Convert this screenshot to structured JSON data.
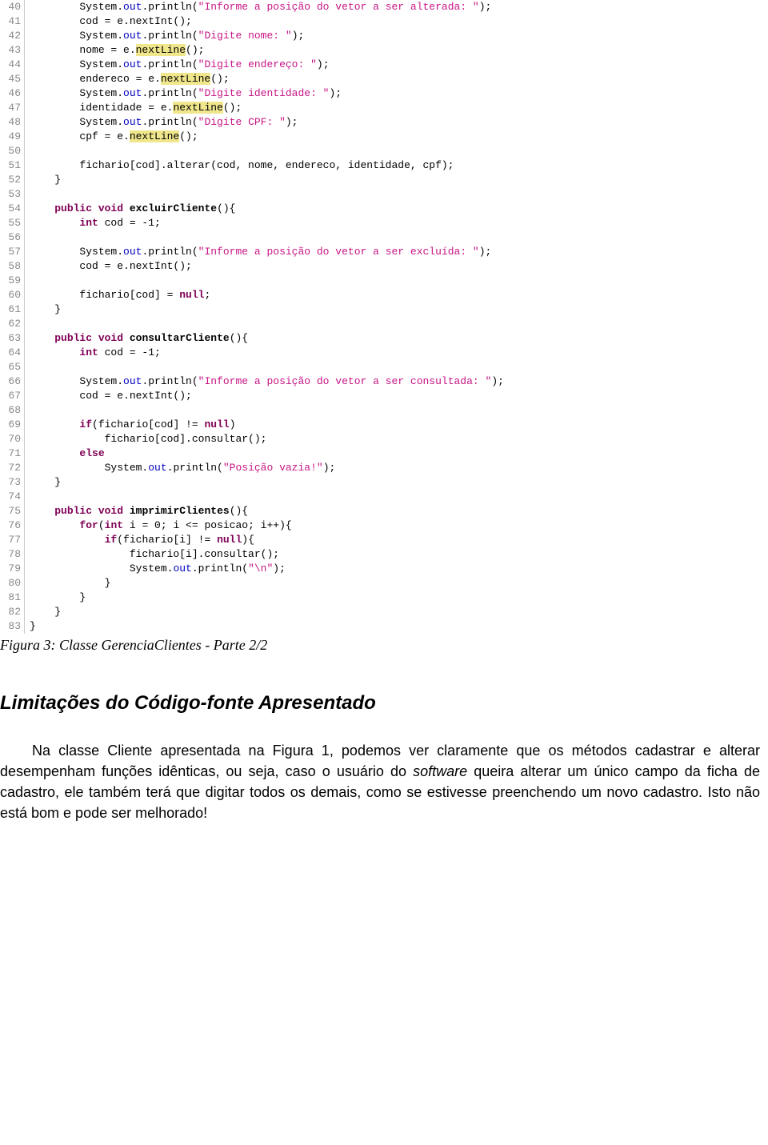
{
  "lines": [
    {
      "n": 40,
      "segs": [
        {
          "t": "        System."
        },
        {
          "t": "out",
          "c": "field"
        },
        {
          "t": ".println("
        },
        {
          "t": "\"Informe a posição do vetor a ser alterada: \"",
          "c": "str"
        },
        {
          "t": ");"
        }
      ]
    },
    {
      "n": 41,
      "segs": [
        {
          "t": "        cod = e.nextInt();"
        }
      ]
    },
    {
      "n": 42,
      "segs": [
        {
          "t": "        System."
        },
        {
          "t": "out",
          "c": "field"
        },
        {
          "t": ".println("
        },
        {
          "t": "\"Digite nome: \"",
          "c": "str"
        },
        {
          "t": ");"
        }
      ]
    },
    {
      "n": 43,
      "segs": [
        {
          "t": "        nome = e."
        },
        {
          "t": "nextLine",
          "c": "hl"
        },
        {
          "t": "();"
        }
      ]
    },
    {
      "n": 44,
      "segs": [
        {
          "t": "        System."
        },
        {
          "t": "out",
          "c": "field"
        },
        {
          "t": ".println("
        },
        {
          "t": "\"Digite endereço: \"",
          "c": "str"
        },
        {
          "t": ");"
        }
      ]
    },
    {
      "n": 45,
      "segs": [
        {
          "t": "        endereco = e."
        },
        {
          "t": "nextLine",
          "c": "hl"
        },
        {
          "t": "();"
        }
      ]
    },
    {
      "n": 46,
      "segs": [
        {
          "t": "        System."
        },
        {
          "t": "out",
          "c": "field"
        },
        {
          "t": ".println("
        },
        {
          "t": "\"Digite identidade: \"",
          "c": "str"
        },
        {
          "t": ");"
        }
      ]
    },
    {
      "n": 47,
      "segs": [
        {
          "t": "        identidade = e."
        },
        {
          "t": "nextLine",
          "c": "hl"
        },
        {
          "t": "();"
        }
      ]
    },
    {
      "n": 48,
      "segs": [
        {
          "t": "        System."
        },
        {
          "t": "out",
          "c": "field"
        },
        {
          "t": ".println("
        },
        {
          "t": "\"Digite CPF: \"",
          "c": "str"
        },
        {
          "t": ");"
        }
      ]
    },
    {
      "n": 49,
      "segs": [
        {
          "t": "        cpf = e."
        },
        {
          "t": "nextLine",
          "c": "hl"
        },
        {
          "t": "();"
        }
      ]
    },
    {
      "n": 50,
      "segs": [
        {
          "t": ""
        }
      ]
    },
    {
      "n": 51,
      "segs": [
        {
          "t": "        fichario[cod].alterar(cod, nome, endereco, identidade, cpf);"
        }
      ]
    },
    {
      "n": 52,
      "segs": [
        {
          "t": "    }"
        }
      ]
    },
    {
      "n": 53,
      "segs": [
        {
          "t": ""
        }
      ]
    },
    {
      "n": 54,
      "segs": [
        {
          "t": "    "
        },
        {
          "t": "public void",
          "c": "kw"
        },
        {
          "t": " "
        },
        {
          "t": "excluirCliente",
          "c": "bold"
        },
        {
          "t": "(){"
        }
      ]
    },
    {
      "n": 55,
      "segs": [
        {
          "t": "        "
        },
        {
          "t": "int",
          "c": "kw"
        },
        {
          "t": " cod = -1;"
        }
      ]
    },
    {
      "n": 56,
      "segs": [
        {
          "t": ""
        }
      ]
    },
    {
      "n": 57,
      "segs": [
        {
          "t": "        System."
        },
        {
          "t": "out",
          "c": "field"
        },
        {
          "t": ".println("
        },
        {
          "t": "\"Informe a posição do vetor a ser excluída: \"",
          "c": "str"
        },
        {
          "t": ");"
        }
      ]
    },
    {
      "n": 58,
      "segs": [
        {
          "t": "        cod = e.nextInt();"
        }
      ]
    },
    {
      "n": 59,
      "segs": [
        {
          "t": ""
        }
      ]
    },
    {
      "n": 60,
      "segs": [
        {
          "t": "        fichario[cod] = "
        },
        {
          "t": "null",
          "c": "kw"
        },
        {
          "t": ";"
        }
      ]
    },
    {
      "n": 61,
      "segs": [
        {
          "t": "    }"
        }
      ]
    },
    {
      "n": 62,
      "segs": [
        {
          "t": ""
        }
      ]
    },
    {
      "n": 63,
      "segs": [
        {
          "t": "    "
        },
        {
          "t": "public void",
          "c": "kw"
        },
        {
          "t": " "
        },
        {
          "t": "consultarCliente",
          "c": "bold"
        },
        {
          "t": "(){"
        }
      ]
    },
    {
      "n": 64,
      "segs": [
        {
          "t": "        "
        },
        {
          "t": "int",
          "c": "kw"
        },
        {
          "t": " cod = -1;"
        }
      ]
    },
    {
      "n": 65,
      "segs": [
        {
          "t": ""
        }
      ]
    },
    {
      "n": 66,
      "segs": [
        {
          "t": "        System."
        },
        {
          "t": "out",
          "c": "field"
        },
        {
          "t": ".println("
        },
        {
          "t": "\"Informe a posição do vetor a ser consultada: \"",
          "c": "str"
        },
        {
          "t": ");"
        }
      ]
    },
    {
      "n": 67,
      "segs": [
        {
          "t": "        cod = e.nextInt();"
        }
      ]
    },
    {
      "n": 68,
      "segs": [
        {
          "t": ""
        }
      ]
    },
    {
      "n": 69,
      "segs": [
        {
          "t": "        "
        },
        {
          "t": "if",
          "c": "kw"
        },
        {
          "t": "(fichario[cod] != "
        },
        {
          "t": "null",
          "c": "kw"
        },
        {
          "t": ")"
        }
      ]
    },
    {
      "n": 70,
      "segs": [
        {
          "t": "            fichario[cod].consultar();"
        }
      ]
    },
    {
      "n": 71,
      "segs": [
        {
          "t": "        "
        },
        {
          "t": "else",
          "c": "kw"
        }
      ]
    },
    {
      "n": 72,
      "segs": [
        {
          "t": "            System."
        },
        {
          "t": "out",
          "c": "field"
        },
        {
          "t": ".println("
        },
        {
          "t": "\"Posição vazia!\"",
          "c": "str"
        },
        {
          "t": ");"
        }
      ]
    },
    {
      "n": 73,
      "segs": [
        {
          "t": "    }"
        }
      ]
    },
    {
      "n": 74,
      "segs": [
        {
          "t": ""
        }
      ]
    },
    {
      "n": 75,
      "segs": [
        {
          "t": "    "
        },
        {
          "t": "public void",
          "c": "kw"
        },
        {
          "t": " "
        },
        {
          "t": "imprimirClientes",
          "c": "bold"
        },
        {
          "t": "(){"
        }
      ]
    },
    {
      "n": 76,
      "segs": [
        {
          "t": "        "
        },
        {
          "t": "for",
          "c": "kw"
        },
        {
          "t": "("
        },
        {
          "t": "int",
          "c": "kw"
        },
        {
          "t": " i = 0; i <= posicao; i++){"
        }
      ]
    },
    {
      "n": 77,
      "segs": [
        {
          "t": "            "
        },
        {
          "t": "if",
          "c": "kw"
        },
        {
          "t": "(fichario[i] != "
        },
        {
          "t": "null",
          "c": "kw"
        },
        {
          "t": "){"
        }
      ]
    },
    {
      "n": 78,
      "segs": [
        {
          "t": "                fichario[i].consultar();"
        }
      ]
    },
    {
      "n": 79,
      "segs": [
        {
          "t": "                System."
        },
        {
          "t": "out",
          "c": "field"
        },
        {
          "t": ".println("
        },
        {
          "t": "\"\\n\"",
          "c": "str"
        },
        {
          "t": ");"
        }
      ]
    },
    {
      "n": 80,
      "segs": [
        {
          "t": "            }"
        }
      ]
    },
    {
      "n": 81,
      "segs": [
        {
          "t": "        }"
        }
      ]
    },
    {
      "n": 82,
      "segs": [
        {
          "t": "    }"
        }
      ]
    },
    {
      "n": 83,
      "segs": [
        {
          "t": "}"
        }
      ]
    }
  ],
  "caption": "Figura 3: Classe GerenciaClientes - Parte 2/2",
  "section_title": "Limitações do Código-fonte Apresentado",
  "body_p1_a": "Na classe Cliente apresentada na Figura 1, podemos ver claramente que os métodos cadastrar e alterar desempenham funções idênticas, ou seja, caso o usuário do ",
  "body_p1_sw": "software",
  "body_p1_b": " queira alterar um único campo da ficha de cadastro, ele também terá que digitar todos os demais, como se estivesse preenchendo um novo cadastro. Isto não está bom e pode ser melhorado!"
}
